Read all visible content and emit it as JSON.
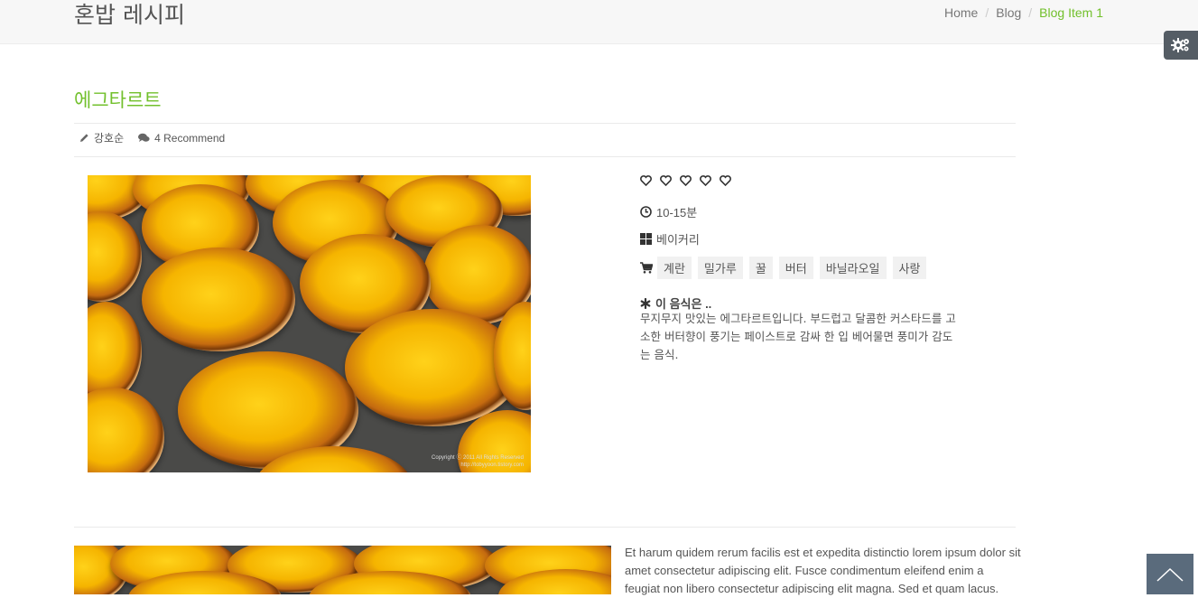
{
  "header": {
    "brand": "혼밥 레시피",
    "breadcrumb": [
      {
        "label": "Home"
      },
      {
        "label": "Blog"
      },
      {
        "label": "Blog Item 1"
      }
    ]
  },
  "post": {
    "title": "에그타르트",
    "author": "강호순",
    "recommend": "4 Recommend",
    "rating": 0,
    "rating_max": 5,
    "time": "10-15분",
    "category": "베이커리",
    "ingredients": [
      "계란",
      "밀가루",
      "꿀",
      "버터",
      "바닐라오일",
      "사랑"
    ],
    "desc_title": "이 음식은 ..",
    "desc_lines": [
      "무지무지 맛있는 에그타르트입니다. 부드럽고 달콤한 커스타드를 고",
      "소한 버터향이 풍기는 페이스트로 감싸 한 입 베어물면 풍미가 감도",
      "는 음식."
    ],
    "watermark_1": "Copyright ⓒ 2011 All Rights Reserved",
    "watermark_2": "http://tobyyoon.tistory.com"
  },
  "second_post": {
    "text_lines": [
      "Et harum quidem rerum facilis est et expedita distinctio lorem ipsum dolor sit",
      "amet consectetur adipiscing elit. Fusce condimentum eleifend enim a",
      "feugiat non libero consectetur adipiscing elit magna. Sed et quam lacus."
    ]
  },
  "icons": {
    "settings": "gears-icon",
    "scroll_top": "chevron-up-icon",
    "author": "pencil-icon",
    "comments": "comments-icon",
    "rating": "heart-outline-icon",
    "time": "clock-icon",
    "category": "grid-icon",
    "ingredients": "cart-icon",
    "description": "asterisk-icon"
  },
  "colors": {
    "accent": "#72c02c",
    "settings_tab": "#555d65",
    "scroll_top": "#5a6b7c"
  }
}
